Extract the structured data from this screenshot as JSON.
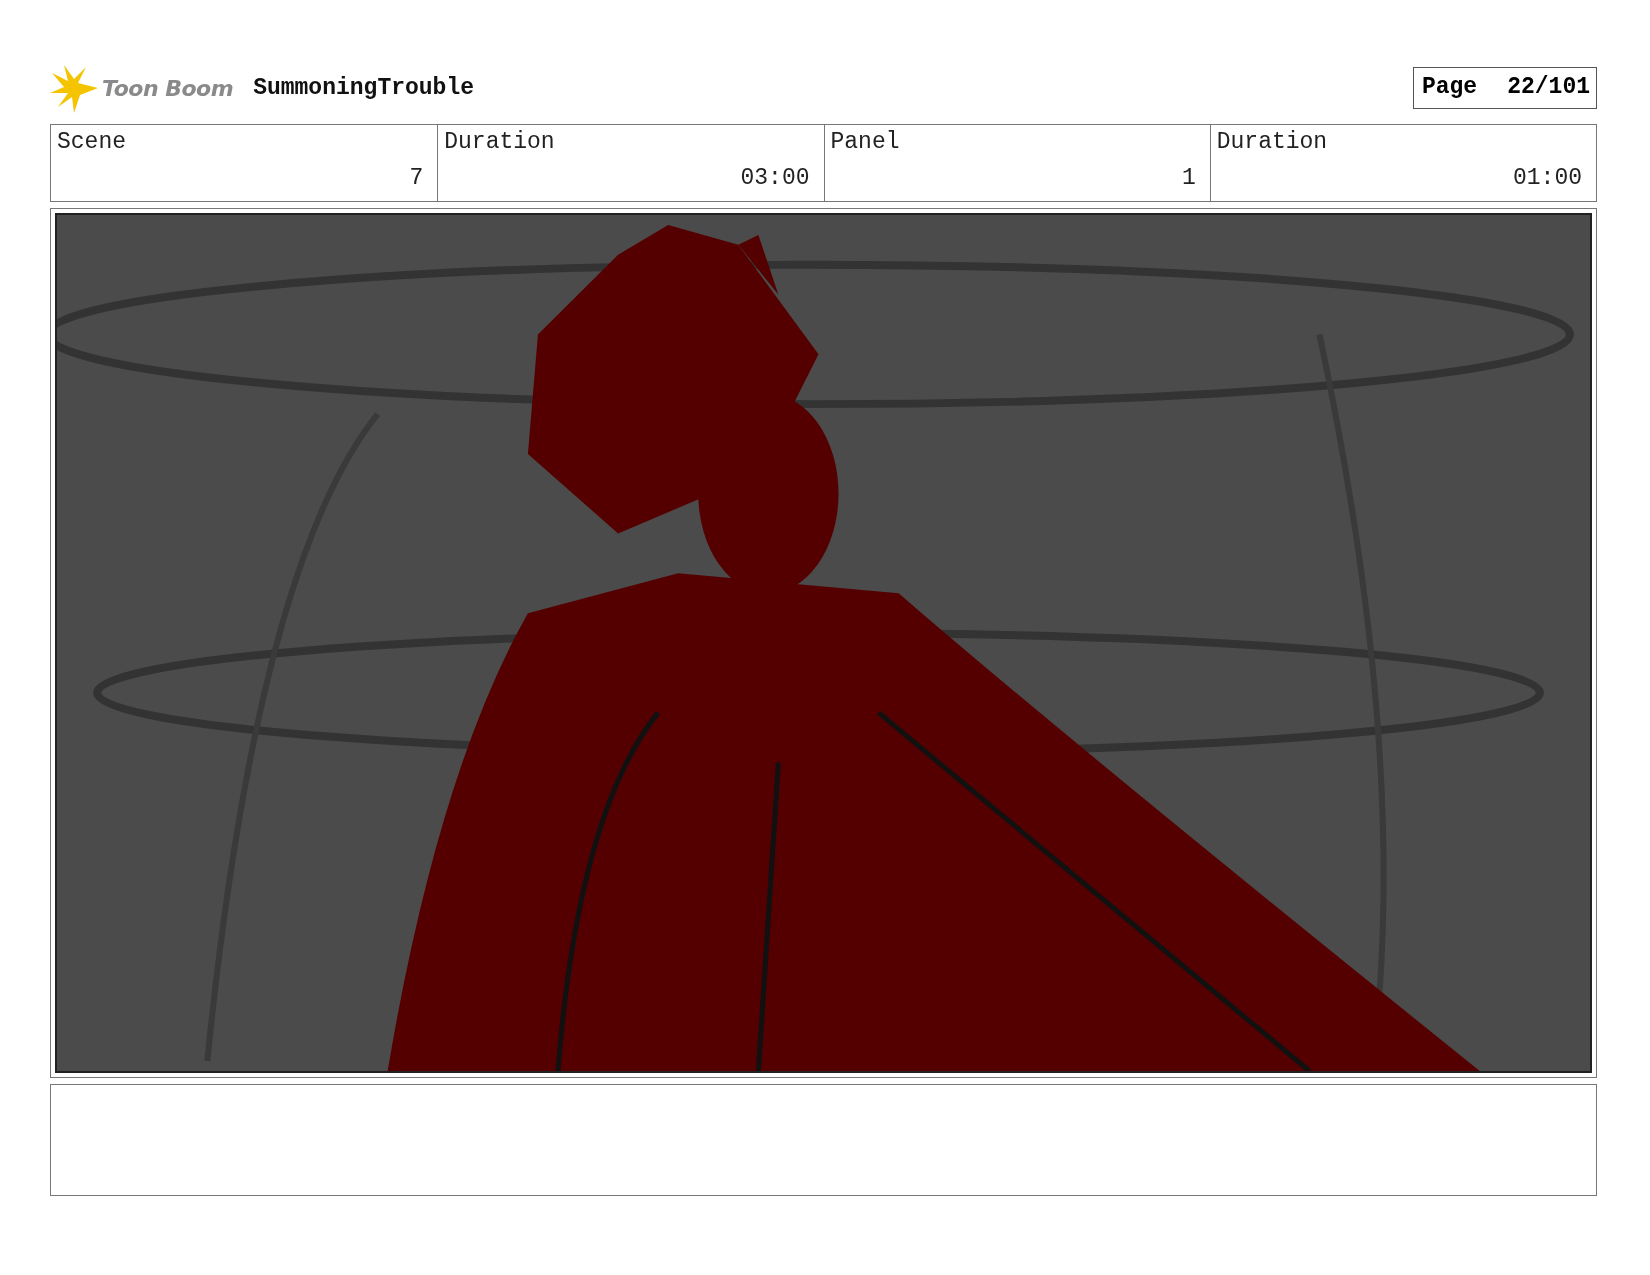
{
  "header": {
    "logo_text": "Toon Boom",
    "project_title": "SummoningTrouble",
    "page_label": "Page",
    "page_number": "22/101"
  },
  "info_fields": [
    {
      "label": "Scene",
      "value": "7"
    },
    {
      "label": "Duration",
      "value": "03:00"
    },
    {
      "label": "Panel",
      "value": "1"
    },
    {
      "label": "Duration",
      "value": "01:00"
    }
  ]
}
